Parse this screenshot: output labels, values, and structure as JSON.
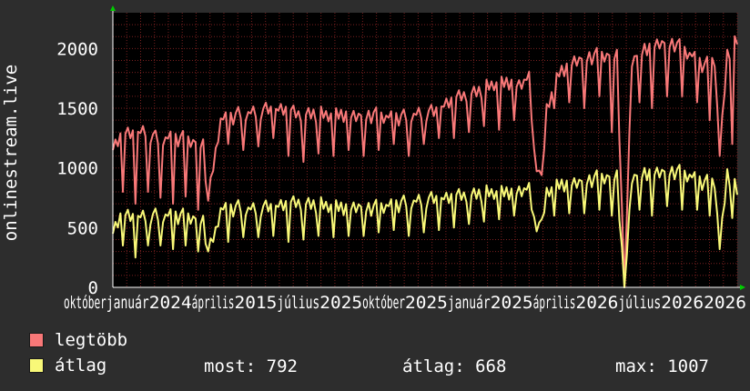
{
  "chart_data": {
    "type": "line",
    "ylabel": "onlinestream.live",
    "ylim": [
      0,
      2300
    ],
    "yticks": [
      0,
      500,
      1000,
      1500,
      2000
    ],
    "x_tick_labels": [
      "október",
      "január",
      "2024",
      "április",
      "2015",
      "július",
      "2025",
      "október",
      "2025",
      "január",
      "2025",
      "április",
      "2026",
      "július",
      "2026",
      "2026"
    ],
    "grid": true,
    "colors": {
      "background": "#000000",
      "grid": "#7a2020",
      "axis": "#ffffff",
      "legtobb": "#f87878",
      "atlag": "#f8f878"
    },
    "series": [
      {
        "name": "legtöbb",
        "color": "#f87878",
        "anchors": [
          [
            0,
            1150
          ],
          [
            3,
            1250
          ],
          [
            8,
            1280
          ],
          [
            13,
            1300
          ],
          [
            18,
            1230
          ],
          [
            23,
            1250
          ],
          [
            28,
            1240
          ],
          [
            32,
            1220
          ],
          [
            36,
            1200
          ],
          [
            38,
            700
          ],
          [
            40,
            1000
          ],
          [
            43,
            1400
          ],
          [
            50,
            1440
          ],
          [
            56,
            1460
          ],
          [
            62,
            1480
          ],
          [
            68,
            1480
          ],
          [
            74,
            1440
          ],
          [
            80,
            1450
          ],
          [
            86,
            1440
          ],
          [
            92,
            1450
          ],
          [
            98,
            1440
          ],
          [
            104,
            1440
          ],
          [
            110,
            1420
          ],
          [
            116,
            1420
          ],
          [
            122,
            1450
          ],
          [
            128,
            1460
          ],
          [
            134,
            1540
          ],
          [
            140,
            1600
          ],
          [
            146,
            1640
          ],
          [
            152,
            1700
          ],
          [
            158,
            1720
          ],
          [
            162,
            1700
          ],
          [
            166,
            1750
          ],
          [
            168,
            1120
          ],
          [
            171,
            870
          ],
          [
            173,
            1500
          ],
          [
            178,
            1800
          ],
          [
            184,
            1900
          ],
          [
            190,
            1930
          ],
          [
            196,
            1940
          ],
          [
            201,
            1950
          ],
          [
            204,
            0
          ],
          [
            207,
            1900
          ],
          [
            212,
            2000
          ],
          [
            218,
            2050
          ],
          [
            224,
            2040
          ],
          [
            230,
            1950
          ],
          [
            236,
            1850
          ],
          [
            240,
            1900
          ],
          [
            242,
            1100
          ],
          [
            245,
            1950
          ],
          [
            249,
            2060
          ]
        ],
        "dips": [
          [
            4,
            800
          ],
          [
            9,
            700
          ],
          [
            14,
            800
          ],
          [
            19,
            750
          ],
          [
            24,
            700
          ],
          [
            29,
            760
          ],
          [
            34,
            650
          ],
          [
            46,
            1200
          ],
          [
            52,
            1150
          ],
          [
            58,
            1180
          ],
          [
            64,
            1250
          ],
          [
            70,
            1100
          ],
          [
            76,
            1050
          ],
          [
            82,
            1120
          ],
          [
            88,
            1100
          ],
          [
            94,
            1150
          ],
          [
            100,
            1100
          ],
          [
            106,
            1150
          ],
          [
            112,
            1200
          ],
          [
            118,
            1100
          ],
          [
            124,
            1200
          ],
          [
            130,
            1250
          ],
          [
            136,
            1250
          ],
          [
            142,
            1300
          ],
          [
            148,
            1350
          ],
          [
            154,
            1320
          ],
          [
            160,
            1400
          ],
          [
            176,
            1500
          ],
          [
            182,
            1550
          ],
          [
            188,
            1500
          ],
          [
            194,
            1600
          ],
          [
            199,
            1300
          ],
          [
            210,
            1550
          ],
          [
            215,
            1500
          ],
          [
            221,
            1600
          ],
          [
            227,
            1600
          ],
          [
            233,
            1550
          ],
          [
            238,
            1400
          ],
          [
            247,
            1200
          ]
        ]
      },
      {
        "name": "átlag",
        "color": "#f8f878",
        "anchors": [
          [
            0,
            450
          ],
          [
            3,
            580
          ],
          [
            8,
            580
          ],
          [
            13,
            590
          ],
          [
            18,
            590
          ],
          [
            23,
            600
          ],
          [
            28,
            590
          ],
          [
            32,
            580
          ],
          [
            36,
            560
          ],
          [
            38,
            300
          ],
          [
            40,
            380
          ],
          [
            43,
            650
          ],
          [
            50,
            660
          ],
          [
            56,
            650
          ],
          [
            62,
            660
          ],
          [
            68,
            680
          ],
          [
            74,
            700
          ],
          [
            80,
            690
          ],
          [
            86,
            680
          ],
          [
            92,
            670
          ],
          [
            98,
            680
          ],
          [
            104,
            660
          ],
          [
            110,
            680
          ],
          [
            116,
            700
          ],
          [
            122,
            720
          ],
          [
            128,
            730
          ],
          [
            134,
            740
          ],
          [
            140,
            760
          ],
          [
            146,
            780
          ],
          [
            152,
            790
          ],
          [
            158,
            800
          ],
          [
            162,
            810
          ],
          [
            166,
            820
          ],
          [
            168,
            550
          ],
          [
            171,
            500
          ],
          [
            173,
            800
          ],
          [
            178,
            860
          ],
          [
            184,
            880
          ],
          [
            190,
            900
          ],
          [
            196,
            920
          ],
          [
            201,
            940
          ],
          [
            204,
            0
          ],
          [
            207,
            920
          ],
          [
            212,
            960
          ],
          [
            218,
            970
          ],
          [
            224,
            970
          ],
          [
            230,
            930
          ],
          [
            236,
            870
          ],
          [
            240,
            880
          ],
          [
            242,
            320
          ],
          [
            245,
            950
          ],
          [
            249,
            800
          ]
        ],
        "dips": [
          [
            4,
            350
          ],
          [
            9,
            250
          ],
          [
            14,
            350
          ],
          [
            19,
            350
          ],
          [
            24,
            320
          ],
          [
            29,
            350
          ],
          [
            34,
            300
          ],
          [
            46,
            380
          ],
          [
            52,
            420
          ],
          [
            58,
            420
          ],
          [
            64,
            430
          ],
          [
            70,
            380
          ],
          [
            76,
            400
          ],
          [
            82,
            430
          ],
          [
            88,
            420
          ],
          [
            94,
            430
          ],
          [
            100,
            430
          ],
          [
            106,
            460
          ],
          [
            112,
            480
          ],
          [
            118,
            430
          ],
          [
            124,
            460
          ],
          [
            130,
            480
          ],
          [
            136,
            500
          ],
          [
            142,
            530
          ],
          [
            148,
            550
          ],
          [
            154,
            570
          ],
          [
            160,
            600
          ],
          [
            176,
            600
          ],
          [
            182,
            620
          ],
          [
            188,
            620
          ],
          [
            194,
            650
          ],
          [
            199,
            600
          ],
          [
            210,
            650
          ],
          [
            215,
            600
          ],
          [
            221,
            680
          ],
          [
            227,
            650
          ],
          [
            233,
            650
          ],
          [
            238,
            600
          ],
          [
            247,
            580
          ]
        ]
      }
    ]
  },
  "legend": [
    {
      "label": "legtöbb",
      "color": "#f87878"
    },
    {
      "label": "átlag",
      "color": "#f8f878"
    }
  ],
  "stats": {
    "most": "most: 792",
    "atlag": "átlag: 668",
    "max": "max: 1007"
  }
}
